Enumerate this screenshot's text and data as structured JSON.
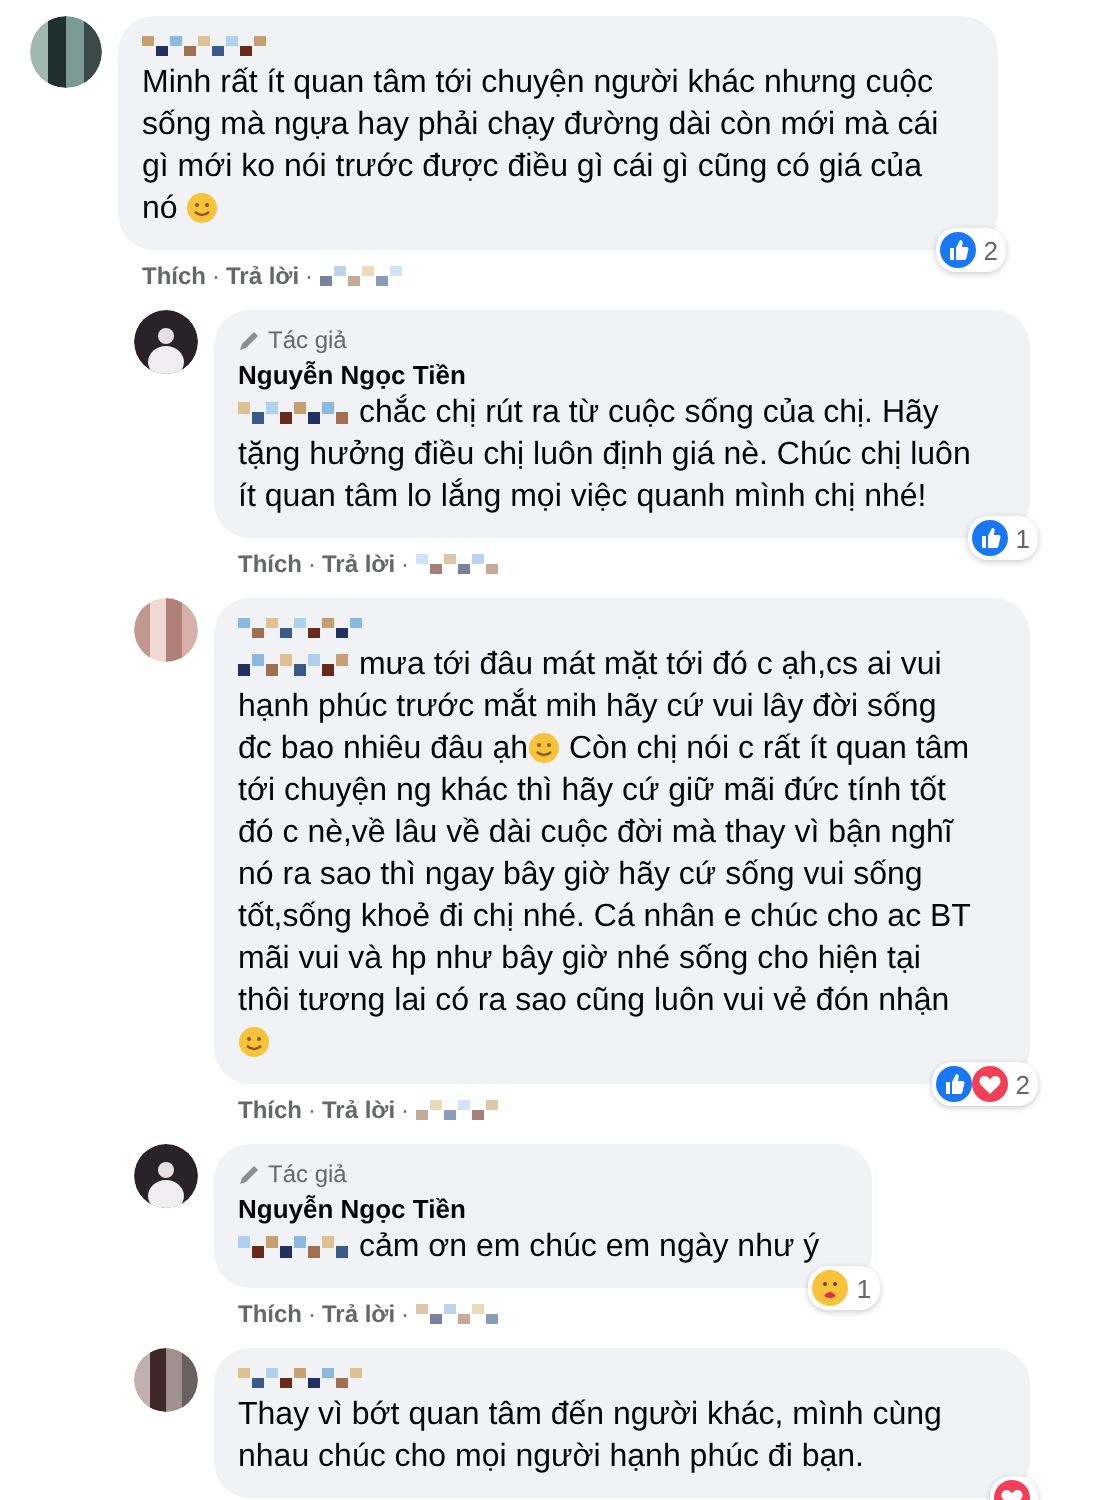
{
  "separator": "·",
  "comments": [
    {
      "kind": "comment",
      "segments": [
        {
          "kind": "text",
          "text": "Minh rất ít quan tâm tới chuyện người khác nhưng cuộc sống mà ngựa hay phải chạy đường dài còn mới mà cái gì mới ko nói trước được điều gì cái gì cũng có giá của nó "
        },
        {
          "kind": "emoji"
        }
      ],
      "reactions": [
        {
          "kind": "like"
        }
      ],
      "reaction_count": "2",
      "actions": [
        "Thích",
        "Trả lời"
      ]
    },
    {
      "kind": "reply",
      "author_badge": "Tác giả",
      "author": "Nguyễn Ngọc Tiền",
      "segments": [
        {
          "kind": "blur"
        },
        {
          "kind": "text",
          "text": " chắc chị rút ra từ cuộc sống của chị. Hãy tặng hưởng điều chị luôn định giá nè. Chúc chị luôn ít quan tâm lo lắng mọi việc quanh mình chị nhé!"
        }
      ],
      "reactions": [
        {
          "kind": "like"
        }
      ],
      "reaction_count": "1",
      "actions": [
        "Thích",
        "Trả lời"
      ]
    },
    {
      "kind": "reply",
      "segments": [
        {
          "kind": "blur"
        },
        {
          "kind": "text",
          "text": " mưa tới đâu mát mặt tới đó c ạh,cs ai vui hạnh phúc trước mắt mih hãy cứ vui lây đời sống đc bao nhiêu đâu ạh"
        },
        {
          "kind": "emoji"
        },
        {
          "kind": "text",
          "text": " Còn chị nói c rất ít quan tâm tới chuyện ng khác thì hãy cứ giữ mãi đức tính tốt đó c nè,về lâu về dài cuộc đời mà thay vì bận nghĩ nó ra sao thì ngay bây giờ hãy cứ sống vui sống tốt,sống khoẻ đi chị nhé. Cá nhân e chúc cho ac BT mãi vui và hp như bây giờ nhé sống cho hiện tại thôi tương lai có ra sao cũng luôn vui vẻ đón nhận"
        },
        {
          "kind": "emoji"
        }
      ],
      "reactions": [
        {
          "kind": "like"
        },
        {
          "kind": "love"
        }
      ],
      "reaction_count": "2",
      "actions": [
        "Thích",
        "Trả lời"
      ]
    },
    {
      "kind": "reply",
      "author_badge": "Tác giả",
      "author": "Nguyễn Ngọc Tiền",
      "segments": [
        {
          "kind": "blur"
        },
        {
          "kind": "text",
          "text": "  cảm ơn em chúc em ngày như ý"
        }
      ],
      "reactions": [
        {
          "kind": "care"
        }
      ],
      "reaction_count": "1",
      "actions": [
        "Thích",
        "Trả lời"
      ]
    },
    {
      "kind": "reply",
      "segments": [
        {
          "kind": "text",
          "text": "Thay vì bớt quan tâm đến người khác, mình cùng nhau chúc cho mọi người hạnh phúc đi bạn."
        }
      ],
      "reactions": [
        {
          "kind": "love"
        }
      ]
    }
  ]
}
